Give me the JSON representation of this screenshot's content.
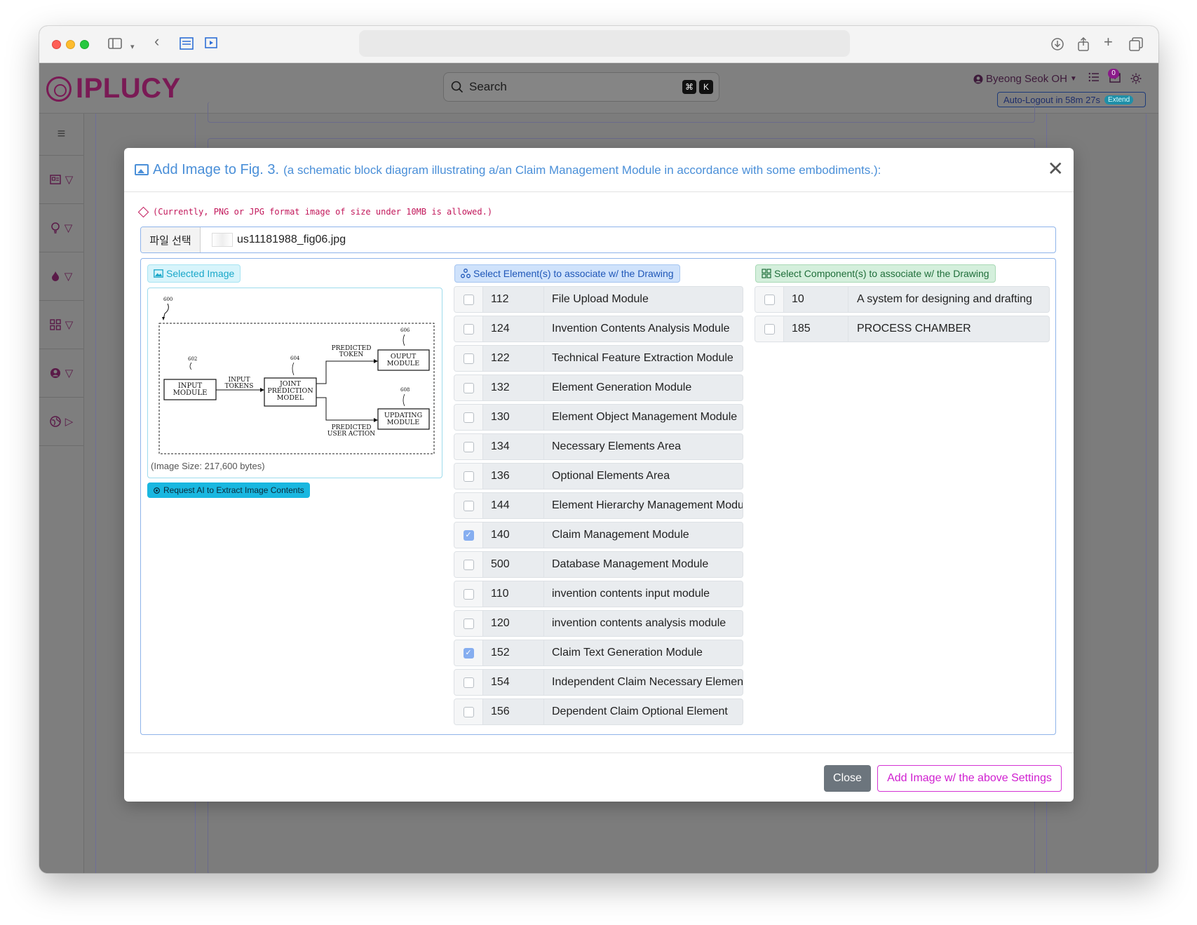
{
  "app": {
    "logo_text": "IPLUCY",
    "search_placeholder": "Search",
    "search_kbd": [
      "⌘",
      "K"
    ],
    "user_name": "Byeong Seok OH",
    "mail_count": "0",
    "autologout_text": "Auto-Logout in 58m 27s",
    "extend_label": "Extend"
  },
  "modal": {
    "title": "Add Image to Fig. 3.",
    "subtitle": "(a schematic block diagram illustrating a/an Claim Management Module in accordance with some embodiments.):",
    "notice": "(Currently, PNG or JPG format image of size under 10MB is allowed.)",
    "file_button": "파일 선택",
    "file_name": "us11181988_fig06.jpg",
    "selected_image_label": "Selected Image",
    "image_size_text": "(Image Size: 217,600 bytes)",
    "ai_button": "Request AI to Extract Image Contents",
    "elements_label": "Select Element(s) to associate w/ the Drawing",
    "components_label": "Select Component(s) to associate w/ the Drawing",
    "elements": [
      {
        "num": "112",
        "name": "File Upload Module",
        "checked": false
      },
      {
        "num": "124",
        "name": "Invention Contents Analysis Module",
        "checked": false
      },
      {
        "num": "122",
        "name": "Technical Feature Extraction Module",
        "checked": false
      },
      {
        "num": "132",
        "name": "Element Generation Module",
        "checked": false
      },
      {
        "num": "130",
        "name": "Element Object Management Module",
        "checked": false
      },
      {
        "num": "134",
        "name": "Necessary Elements Area",
        "checked": false
      },
      {
        "num": "136",
        "name": "Optional Elements Area",
        "checked": false
      },
      {
        "num": "144",
        "name": "Element Hierarchy Management Module",
        "checked": false
      },
      {
        "num": "140",
        "name": "Claim Management Module",
        "checked": true
      },
      {
        "num": "500",
        "name": "Database Management Module",
        "checked": false
      },
      {
        "num": "110",
        "name": "invention contents input module",
        "checked": false
      },
      {
        "num": "120",
        "name": "invention contents analysis module",
        "checked": false
      },
      {
        "num": "152",
        "name": "Claim Text Generation Module",
        "checked": true
      },
      {
        "num": "154",
        "name": "Independent Claim Necessary Elements",
        "checked": false
      },
      {
        "num": "156",
        "name": "Dependent Claim Optional Element",
        "checked": false
      }
    ],
    "components": [
      {
        "num": "10",
        "name": "A system for designing and drafting",
        "checked": false
      },
      {
        "num": "185",
        "name": "PROCESS CHAMBER",
        "checked": false
      }
    ],
    "close_button": "Close",
    "add_button": "Add Image w/ the above Settings"
  },
  "diagram": {
    "ref_600": "600",
    "ref_602": "602",
    "ref_604": "604",
    "ref_606": "606",
    "ref_608": "608",
    "input_module": [
      "INPUT",
      "MODULE"
    ],
    "input_tokens": [
      "INPUT",
      "TOKENS"
    ],
    "joint_model": [
      "JOINT",
      "PREDICTION",
      "MODEL"
    ],
    "predicted_token": [
      "PREDICTED",
      "TOKEN"
    ],
    "output_module": [
      "OUPUT",
      "MODULE"
    ],
    "predicted_action": [
      "PREDICTED",
      "USER ACTION"
    ],
    "updating_module": [
      "UPDATING",
      "MODULE"
    ]
  }
}
